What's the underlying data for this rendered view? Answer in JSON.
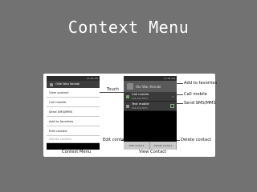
{
  "slide": {
    "title": "Context Menu"
  },
  "context_menu_phone": {
    "status_time": "10:38 AM",
    "contact_name": "Ollie Wan Kenobi",
    "menu_items": [
      "View contact",
      "Call mobile",
      "Send SMS/MMS",
      "Add to favorites",
      "Edit contact",
      "Delete contact"
    ],
    "caption": "Context Menu"
  },
  "view_contact_phone": {
    "status_time": "10:38 AM",
    "contact_name": "Obi Wan Kenobi",
    "rows": [
      {
        "label": "Call mobile",
        "sub": "234-324-5675"
      },
      {
        "label": "Text mobile",
        "sub": "234-324-5675"
      }
    ],
    "bottom_buttons": [
      "Edit contact",
      "Delete contact"
    ],
    "caption": "View Contact"
  },
  "callouts": {
    "touch": "Touch",
    "add_to_favorites": "Add to favorites",
    "call_mobile": "Call mobile",
    "send_sms": "Send SMS/MMS",
    "edit_contact": "Edit contact",
    "delete_contact": "Delete contact"
  }
}
